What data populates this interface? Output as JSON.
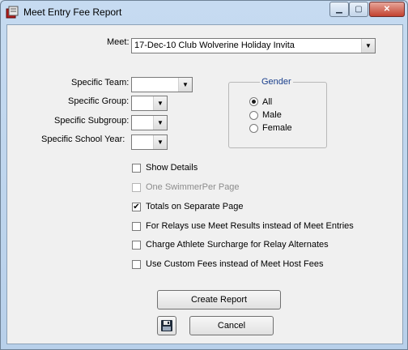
{
  "window": {
    "title": "Meet Entry Fee Report",
    "controls": {
      "minimize": "▁",
      "maximize": "▢",
      "close": "✕"
    }
  },
  "form": {
    "meet_label": "Meet:",
    "meet_value": "17-Dec-10 Club Wolverine Holiday Invita",
    "team_label": "Specific Team:",
    "group_label": "Specific Group:",
    "subgroup_label": "Specific Subgroup:",
    "school_year_label": "Specific  School Year:"
  },
  "gender": {
    "title": "Gender",
    "options": [
      "All",
      "Male",
      "Female"
    ],
    "selected": "All"
  },
  "options": [
    {
      "label": "Show Details",
      "checked": false,
      "disabled": false
    },
    {
      "label": "One SwimmerPer Page",
      "checked": false,
      "disabled": true
    },
    {
      "label": "Totals on Separate Page",
      "checked": true,
      "disabled": false
    },
    {
      "label": "For Relays use Meet Results instead of Meet Entries",
      "checked": false,
      "disabled": false
    },
    {
      "label": "Charge Athlete Surcharge for Relay Alternates",
      "checked": false,
      "disabled": false
    },
    {
      "label": "Use Custom Fees instead of Meet Host Fees",
      "checked": false,
      "disabled": false
    }
  ],
  "buttons": {
    "create": "Create Report",
    "cancel": "Cancel"
  },
  "icons": {
    "app": "report-app-icon",
    "save": "floppy-disk-icon"
  }
}
